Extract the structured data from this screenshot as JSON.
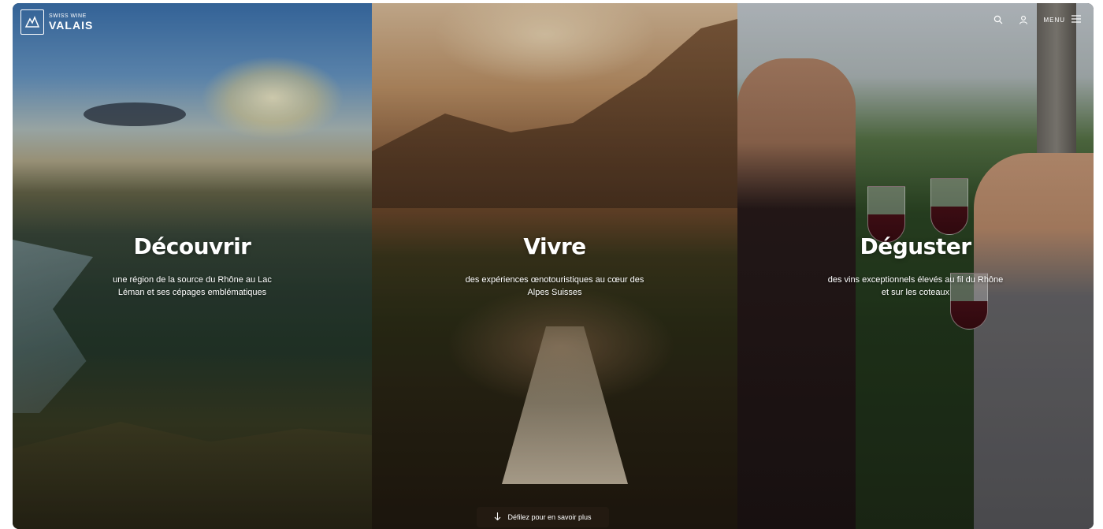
{
  "brand": {
    "tagline": "SWISS WINE",
    "name": "VALAIS"
  },
  "header": {
    "menu_label": "MENU"
  },
  "panels": [
    {
      "title": "Découvrir",
      "subtitle": "une région de la source du Rhône au Lac Léman et ses cépages emblématiques"
    },
    {
      "title": "Vivre",
      "subtitle": "des expériences œnotouristiques au cœur des Alpes Suisses"
    },
    {
      "title": "Déguster",
      "subtitle": "des vins exceptionnels élevés au fil du Rhône et sur les coteaux"
    }
  ],
  "scroll_hint": {
    "label": "Défilez pour en savoir plus"
  }
}
